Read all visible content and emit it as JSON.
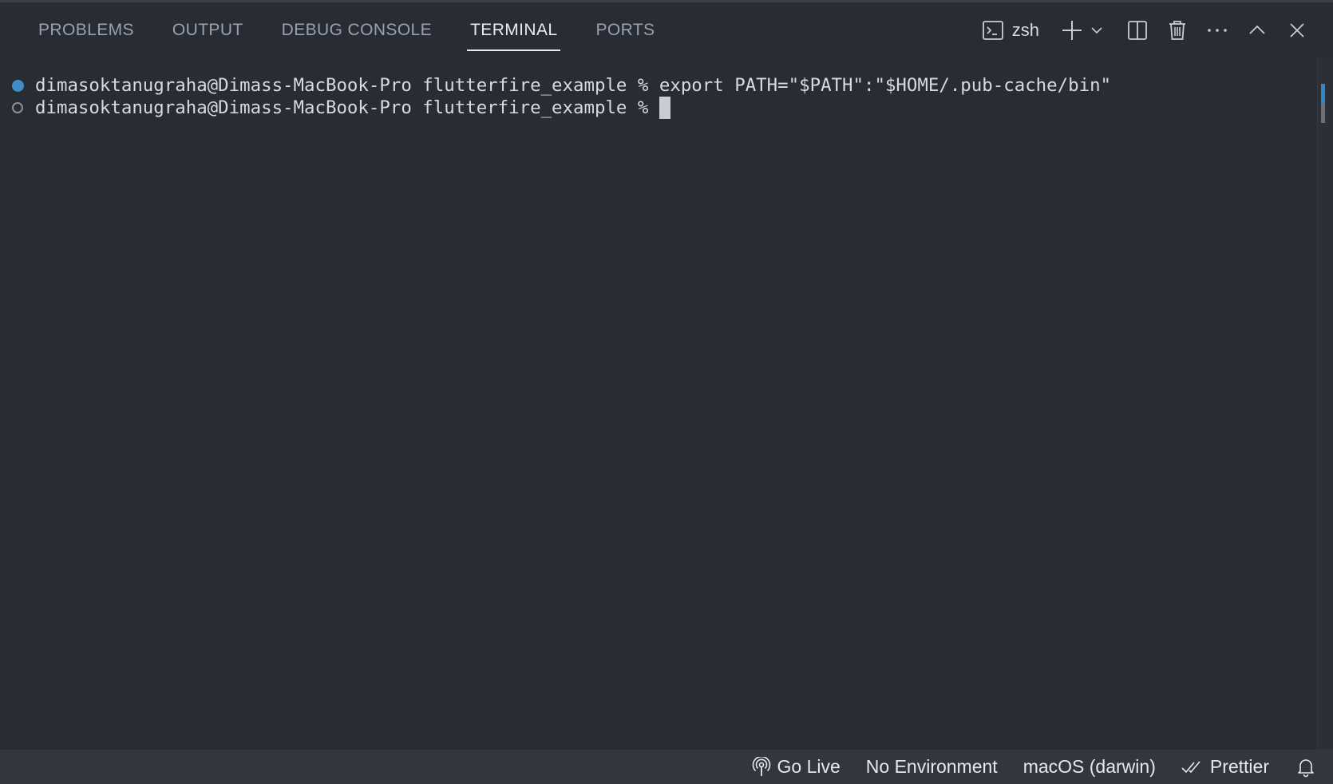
{
  "panel": {
    "tabs": [
      {
        "label": "PROBLEMS",
        "active": false
      },
      {
        "label": "OUTPUT",
        "active": false
      },
      {
        "label": "DEBUG CONSOLE",
        "active": false
      },
      {
        "label": "TERMINAL",
        "active": true
      },
      {
        "label": "PORTS",
        "active": false
      }
    ],
    "actions": {
      "shell_label": "zsh",
      "icons": [
        "terminal-icon",
        "plus-icon",
        "chevron-down-icon",
        "split-icon",
        "trash-icon",
        "more-icon",
        "chevron-up-icon",
        "close-icon"
      ]
    }
  },
  "terminal": {
    "lines": [
      {
        "decoration": "success",
        "prompt": "dimasoktanugraha@Dimass-MacBook-Pro flutterfire_example % ",
        "command": "export PATH=\"$PATH\":\"$HOME/.pub-cache/bin\""
      },
      {
        "decoration": "pending",
        "prompt": "dimasoktanugraha@Dimass-MacBook-Pro flutterfire_example % ",
        "command": ""
      }
    ],
    "colors": {
      "background": "#282c34",
      "decoration_success": "#3f8fc7",
      "text": "#d7dae0"
    }
  },
  "statusbar": {
    "go_live": "Go Live",
    "environment": "No Environment",
    "os": "macOS (darwin)",
    "prettier": "Prettier",
    "icons": [
      "broadcast-icon",
      "double-check-icon",
      "bell-icon"
    ],
    "background": "#32363e"
  }
}
